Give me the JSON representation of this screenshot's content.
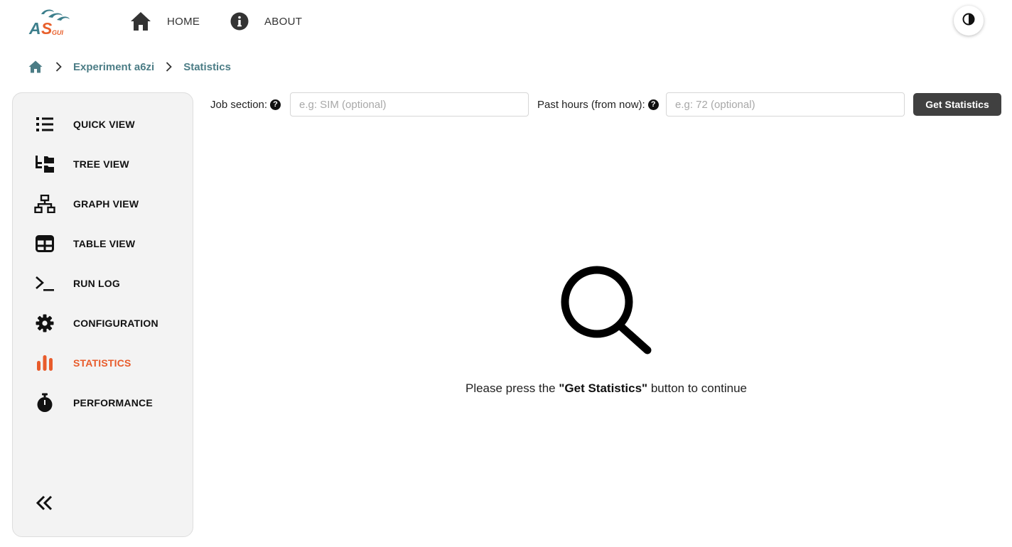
{
  "app": {
    "logo_text_main": "AS",
    "logo_text_sub": "GUI"
  },
  "nav": {
    "home": {
      "label": "HOME",
      "icon": "home-icon"
    },
    "about": {
      "label": "ABOUT",
      "icon": "info-circle-icon"
    },
    "theme_toggle_icon": "contrast-icon"
  },
  "breadcrumb": {
    "home_icon": "home-icon",
    "items": [
      "Experiment a6zi",
      "Statistics"
    ]
  },
  "sidebar": {
    "items": [
      {
        "label": "QUICK VIEW",
        "icon": "list-icon",
        "active": false
      },
      {
        "label": "TREE VIEW",
        "icon": "tree-icon",
        "active": false
      },
      {
        "label": "GRAPH VIEW",
        "icon": "graph-icon",
        "active": false
      },
      {
        "label": "TABLE VIEW",
        "icon": "table-icon",
        "active": false
      },
      {
        "label": "RUN LOG",
        "icon": "terminal-icon",
        "active": false
      },
      {
        "label": "CONFIGURATION",
        "icon": "gear-icon",
        "active": false
      },
      {
        "label": "STATISTICS",
        "icon": "bar-chart-icon",
        "active": true
      },
      {
        "label": "PERFORMANCE",
        "icon": "stopwatch-icon",
        "active": false
      }
    ],
    "collapse_icon": "double-chevron-left-icon"
  },
  "filters": {
    "job_section": {
      "label": "Job section:",
      "placeholder": "e.g: SIM (optional)",
      "value": ""
    },
    "past_hours": {
      "label": "Past hours (from now):",
      "placeholder": "e.g: 72 (optional)",
      "value": ""
    },
    "help_glyph": "?",
    "submit_label": "Get Statistics"
  },
  "empty_state": {
    "icon": "search-icon",
    "prefix": "Please press the ",
    "highlight": "\"Get Statistics\"",
    "suffix": " button to continue"
  },
  "colors": {
    "accent": "#e85b2b",
    "breadcrumb": "#4c7d86",
    "logo_teal": "#3d7f8c",
    "logo_orange": "#e8602c",
    "button_bg": "#404040",
    "sidebar_bg": "#f3f3f3"
  }
}
